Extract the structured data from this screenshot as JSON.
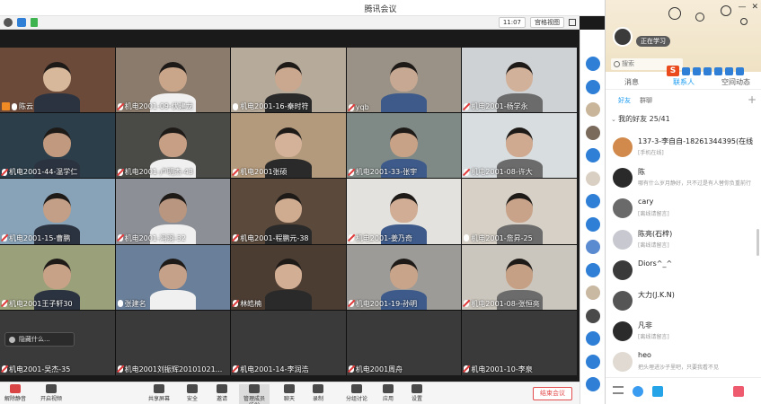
{
  "window": {
    "title": "腾讯会议",
    "time": "11:07",
    "view_mode": "宫格视图"
  },
  "grid": {
    "tiles": [
      {
        "label": "陈云",
        "host": true,
        "mic": "normal",
        "bg": "#6b4a3a",
        "skin": "#d8b89a"
      },
      {
        "label": "机电2001-09-伏建龙",
        "mic": "muted",
        "bg": "#8a7b6c",
        "skin": "#c9a58a"
      },
      {
        "label": "机电2001-16-秦时符",
        "mic": "normal",
        "bg": "#b6aa9a",
        "skin": "#caa88f"
      },
      {
        "label": "yqb",
        "mic": "muted",
        "bg": "#9a9286",
        "skin": "#c7a993"
      },
      {
        "label": "机电2001-杨学永",
        "mic": "muted",
        "bg": "#cfd2d4",
        "skin": "#d2b19a"
      },
      {
        "label": "机电2001-44-温学仁",
        "mic": "muted",
        "bg": "#2c3e4a",
        "skin": "#c0997e"
      },
      {
        "label": "机电2001-卢明杰-43",
        "mic": "muted",
        "bg": "#4a4a46",
        "skin": "#c69f85"
      },
      {
        "label": "机电2001张硕",
        "mic": "muted",
        "bg": "#b49a7c",
        "skin": "#d4b299"
      },
      {
        "label": "机电2001-33-张宇",
        "mic": "muted",
        "bg": "#7f8a86",
        "skin": "#c8a287"
      },
      {
        "label": "机电2001-08-许大",
        "mic": "muted",
        "bg": "#d8dde0",
        "skin": "#cfaa90"
      },
      {
        "label": "机电2001-15-曹鹏",
        "mic": "muted",
        "bg": "#88a3b8",
        "skin": "#c29f86"
      },
      {
        "label": "机电2001-冯羽-32",
        "mic": "muted",
        "bg": "#8c8f95",
        "skin": "#b99680"
      },
      {
        "label": "机电2001-程鹏元-38",
        "mic": "muted",
        "bg": "#5b4a3c",
        "skin": "#cfab90"
      },
      {
        "label": "机电2001-姜乃奇",
        "mic": "muted",
        "bg": "#e4e2de",
        "skin": "#d0ad94"
      },
      {
        "label": "机电2001-詹昇-25",
        "mic": "normal",
        "bg": "#d6d0c6",
        "skin": "#c8a38a"
      },
      {
        "label": "机电2001王子轩30",
        "mic": "muted",
        "bg": "#9aa07a",
        "skin": "#c7a286"
      },
      {
        "label": "张建名",
        "mic": "normal",
        "bg": "#6a7f99",
        "skin": "#c5a18a"
      },
      {
        "label": "林皓楠",
        "mic": "muted",
        "bg": "#4c3d33",
        "skin": "#d2ae94"
      },
      {
        "label": "机电2001-19-孙明",
        "mic": "muted",
        "bg": "#9c9b98",
        "skin": "#c8a48a"
      },
      {
        "label": "机电2001-08-张恒亮",
        "mic": "muted",
        "bg": "#cbc6bd",
        "skin": "#c6a085"
      },
      {
        "label": "机电2001-吴杰-35",
        "mic": "muted",
        "bg": "#3a3a3a",
        "skin": ""
      },
      {
        "label": "机电2001刘振辉20101021...",
        "mic": "muted",
        "bg": "#3a3a3a",
        "skin": ""
      },
      {
        "label": "机电2001-14-李润浩",
        "mic": "muted",
        "bg": "#3a3a3a",
        "skin": ""
      },
      {
        "label": "机电2001周舟",
        "mic": "muted",
        "bg": "#3a3a3a",
        "skin": ""
      },
      {
        "label": "机电2001-10-李泉",
        "mic": "muted",
        "bg": "#3a3a3a",
        "skin": ""
      }
    ],
    "tooltip_text": "隐藏什么..."
  },
  "toolbar": {
    "items": [
      {
        "label": "解除静音"
      },
      {
        "label": "开启视频"
      },
      {
        "label": "共享屏幕"
      },
      {
        "label": "安全"
      },
      {
        "label": "邀请"
      },
      {
        "label": "管理成员(50)"
      },
      {
        "label": "聊天"
      },
      {
        "label": "录制"
      },
      {
        "label": "分组讨论"
      },
      {
        "label": "应用"
      },
      {
        "label": "设置"
      }
    ],
    "end_label": "结束会议"
  },
  "qq": {
    "status": "正在学习",
    "search_placeholder": "搜索",
    "tabs": [
      "消息",
      "联系人",
      "空间动态"
    ],
    "subtabs": [
      "好友",
      "群聊"
    ],
    "group_header": "我的好友 25/41",
    "contacts": [
      {
        "name": "137-3-李自自-18261344395(在线",
        "sign": "[手机在线]",
        "color": "#d28a4c"
      },
      {
        "name": "陈",
        "sign": "哪有什么岁月静好，只不过是有人替你负重前行",
        "color": "#2a2a2a"
      },
      {
        "name": "cary",
        "sign": "[离线请留言]",
        "color": "#6a6a6a"
      },
      {
        "name": "陈亮(石梓)",
        "sign": "[离线请留言]",
        "color": "#c8c8d0"
      },
      {
        "name": "Diors^_^",
        "sign": "",
        "color": "#3a3a3a"
      },
      {
        "name": "大力(J.K.N)",
        "sign": "",
        "color": "#555"
      },
      {
        "name": "凡非",
        "sign": "[离线请留言]",
        "color": "#2b2b2b"
      },
      {
        "name": "heo",
        "sign": "把头埋进沙子里吧，只要我看不见",
        "color": "#e0dad2"
      }
    ]
  }
}
